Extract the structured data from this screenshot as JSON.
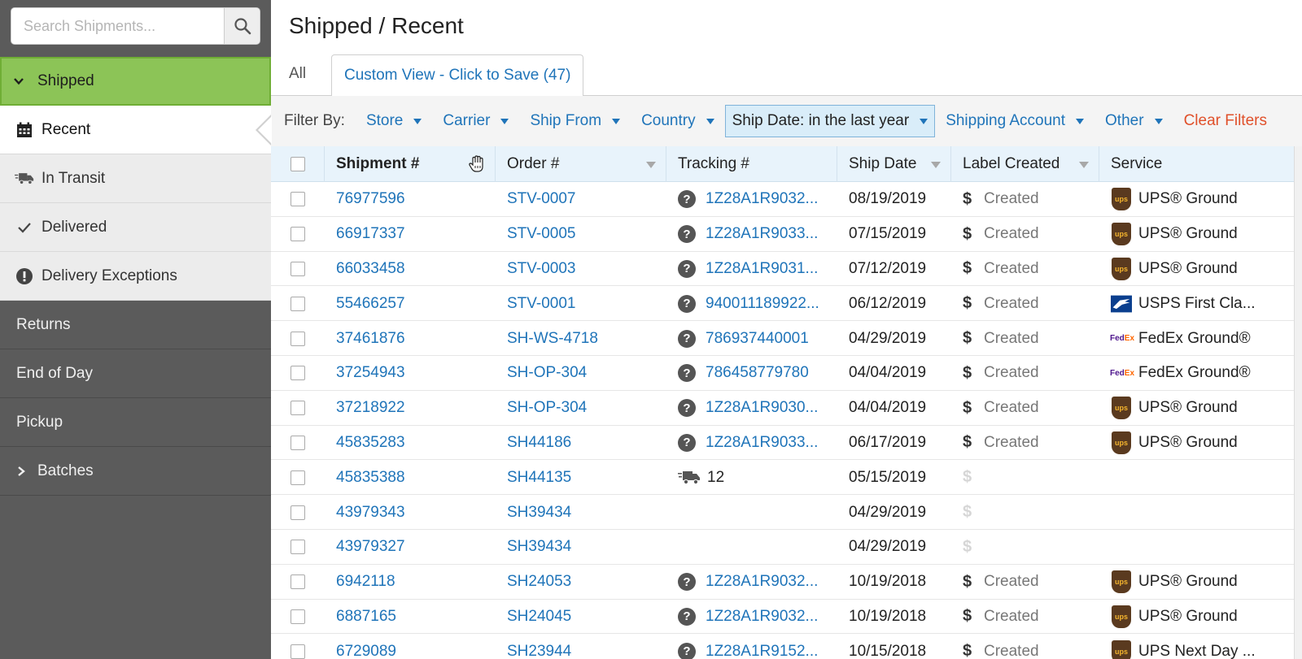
{
  "sidebar": {
    "search_placeholder": "Search Shipments...",
    "shipped_label": "Shipped",
    "sub_items": [
      {
        "label": "Recent",
        "icon": "calendar-icon"
      },
      {
        "label": "In Transit",
        "icon": "truck-icon"
      },
      {
        "label": "Delivered",
        "icon": "check-icon"
      },
      {
        "label": "Delivery Exceptions",
        "icon": "exclamation-icon"
      }
    ],
    "dark_items": [
      {
        "label": "Returns"
      },
      {
        "label": "End of Day"
      },
      {
        "label": "Pickup"
      },
      {
        "label": "Batches",
        "icon": "chevron-right-icon"
      }
    ]
  },
  "header": {
    "title": "Shipped / Recent"
  },
  "tabs": {
    "all": "All",
    "custom": "Custom View - Click to Save (47)"
  },
  "filters": {
    "label": "Filter By:",
    "items": [
      "Store",
      "Carrier",
      "Ship From",
      "Country",
      "Ship Date: in the last year",
      "Shipping Account",
      "Other"
    ],
    "clear": "Clear Filters"
  },
  "table": {
    "columns": [
      "Shipment #",
      "Order #",
      "Tracking #",
      "Ship Date",
      "Label Created",
      "Service"
    ],
    "rows": [
      {
        "shipment": "76977596",
        "order": "STV-0007",
        "tracking": "1Z28A1R9032...",
        "track_icon": "question",
        "date": "08/19/2019",
        "label": "Created",
        "carrier": "ups",
        "service": "UPS® Ground"
      },
      {
        "shipment": "66917337",
        "order": "STV-0005",
        "tracking": "1Z28A1R9033...",
        "track_icon": "question",
        "date": "07/15/2019",
        "label": "Created",
        "carrier": "ups",
        "service": "UPS® Ground"
      },
      {
        "shipment": "66033458",
        "order": "STV-0003",
        "tracking": "1Z28A1R9031...",
        "track_icon": "question",
        "date": "07/12/2019",
        "label": "Created",
        "carrier": "ups",
        "service": "UPS® Ground"
      },
      {
        "shipment": "55466257",
        "order": "STV-0001",
        "tracking": "940011189922...",
        "track_icon": "question",
        "date": "06/12/2019",
        "label": "Created",
        "carrier": "usps",
        "service": "USPS First Cla..."
      },
      {
        "shipment": "37461876",
        "order": "SH-WS-4718",
        "tracking": "786937440001",
        "track_icon": "question",
        "date": "04/29/2019",
        "label": "Created",
        "carrier": "fedex",
        "service": "FedEx Ground®"
      },
      {
        "shipment": "37254943",
        "order": "SH-OP-304",
        "tracking": "786458779780",
        "track_icon": "question",
        "date": "04/04/2019",
        "label": "Created",
        "carrier": "fedex",
        "service": "FedEx Ground®"
      },
      {
        "shipment": "37218922",
        "order": "SH-OP-304",
        "tracking": "1Z28A1R9030...",
        "track_icon": "question",
        "date": "04/04/2019",
        "label": "Created",
        "carrier": "ups",
        "service": "UPS® Ground"
      },
      {
        "shipment": "45835283",
        "order": "SH44186",
        "tracking": "1Z28A1R9033...",
        "track_icon": "question",
        "date": "06/17/2019",
        "label": "Created",
        "carrier": "ups",
        "service": "UPS® Ground"
      },
      {
        "shipment": "45835388",
        "order": "SH44135",
        "tracking": "12",
        "track_icon": "truck",
        "date": "05/15/2019",
        "label": "",
        "carrier": "",
        "service": ""
      },
      {
        "shipment": "43979343",
        "order": "SH39434",
        "tracking": "",
        "track_icon": "",
        "date": "04/29/2019",
        "label": "",
        "carrier": "",
        "service": ""
      },
      {
        "shipment": "43979327",
        "order": "SH39434",
        "tracking": "",
        "track_icon": "",
        "date": "04/29/2019",
        "label": "",
        "carrier": "",
        "service": ""
      },
      {
        "shipment": "6942118",
        "order": "SH24053",
        "tracking": "1Z28A1R9032...",
        "track_icon": "question",
        "date": "10/19/2018",
        "label": "Created",
        "carrier": "ups",
        "service": "UPS® Ground"
      },
      {
        "shipment": "6887165",
        "order": "SH24045",
        "tracking": "1Z28A1R9032...",
        "track_icon": "question",
        "date": "10/19/2018",
        "label": "Created",
        "carrier": "ups",
        "service": "UPS® Ground"
      },
      {
        "shipment": "6729089",
        "order": "SH23944",
        "tracking": "1Z28A1R9152...",
        "track_icon": "question",
        "date": "10/15/2018",
        "label": "Created",
        "carrier": "ups",
        "service": "UPS Next Day ..."
      }
    ]
  },
  "carrier_logos": {
    "ups": "ups",
    "fedex_fe": "Fed",
    "fedex_ex": "Ex"
  },
  "colors": {
    "accent_link": "#1f74b9",
    "shipped_green": "#8cc457",
    "clear_filters": "#e0502a",
    "sidebar_dark": "#5b5b5b"
  }
}
